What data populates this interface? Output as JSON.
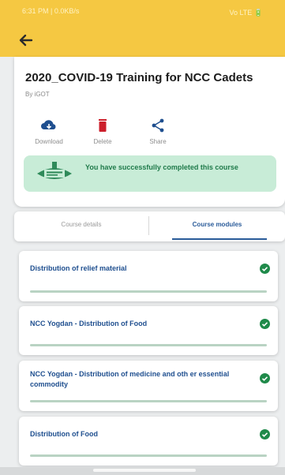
{
  "status_bar": {
    "time": "6:31 PM | 0.0KB/s",
    "indicators": "Vo LTE 🔋"
  },
  "header": {
    "back_icon": "back-arrow-icon",
    "title": "2020_COVID-19 Training for NCC Cadets",
    "byline": "By iGOT"
  },
  "actions": [
    {
      "label": "Download",
      "icon": "cloud-download-icon",
      "color": "#1f4f8f"
    },
    {
      "label": "Delete",
      "icon": "trash-icon",
      "color": "#cc1f2b"
    },
    {
      "label": "Share",
      "icon": "share-icon",
      "color": "#1f4f8f"
    }
  ],
  "completion": {
    "message": "You have successfully completed this course",
    "icon": "certificate-badge-icon"
  },
  "tabs": [
    {
      "label": "Course details",
      "active": false
    },
    {
      "label": "Course modules",
      "active": true
    }
  ],
  "modules": [
    {
      "name": "Distribution of relief material",
      "completed": true
    },
    {
      "name": "NCC Yogdan - Distribution of Food",
      "completed": true
    },
    {
      "name": "NCC Yogdan - Distribution of medicine and oth er essential commodity",
      "completed": true
    },
    {
      "name": "Distribution of Food",
      "completed": true
    }
  ],
  "colors": {
    "accent": "#f5c842",
    "primary": "#1f4f8f",
    "success": "#1f7a4a"
  }
}
